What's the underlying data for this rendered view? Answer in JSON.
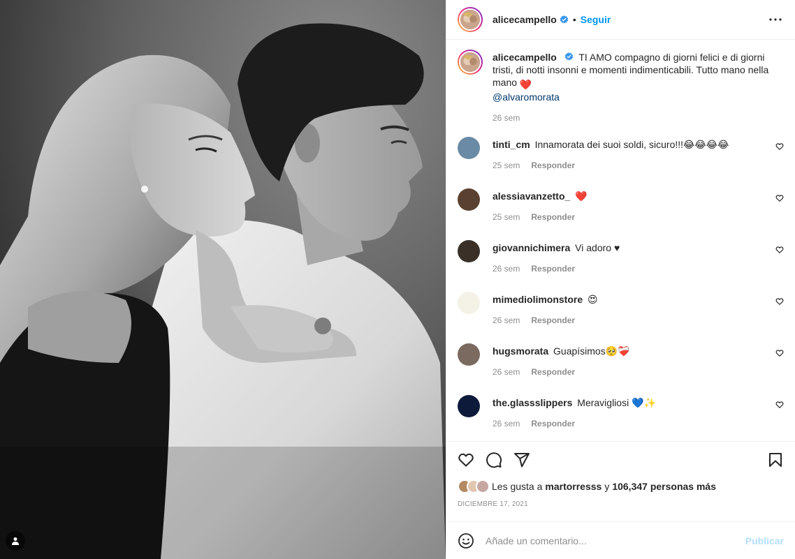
{
  "post": {
    "author": {
      "username": "alicecampello",
      "verified": true,
      "follow_label": "Seguir",
      "separator": "•"
    },
    "caption": {
      "text": "TI AMO compagno di giorni felici e di giorni tristi, di notti insonni e momenti indimenticabili. Tutto mano nella mano",
      "emoji": "❤️",
      "mention": "@alvaromorata",
      "time": "26 sem"
    },
    "comments": [
      {
        "username": "tinti_cm",
        "text": "Innamorata dei suoi soldi, sicuro!!!😂😂😂😂",
        "time": "25 sem",
        "reply_label": "Responder",
        "avatar_color": "#6a8aa5"
      },
      {
        "username": "alessiavanzetto_",
        "text": "❤️",
        "time": "25 sem",
        "reply_label": "Responder",
        "avatar_color": "#5a4030"
      },
      {
        "username": "giovannichimera",
        "text": "Vi adoro ♥",
        "time": "26 sem",
        "reply_label": "Responder",
        "avatar_color": "#3a3028"
      },
      {
        "username": "mimediolimonstore",
        "text": "😍",
        "time": "26 sem",
        "reply_label": "Responder",
        "avatar_color": "#f4f1e6"
      },
      {
        "username": "hugsmorata",
        "text": "Guapísimos🥺❤️‍🩹",
        "time": "26 sem",
        "reply_label": "Responder",
        "avatar_color": "#7a6a60"
      },
      {
        "username": "the.glassslippers",
        "text": "Meravigliosi 💙✨",
        "time": "26 sem",
        "reply_label": "Responder",
        "avatar_color": "#0d1a3a"
      }
    ],
    "likes": {
      "prefix": "Les gusta a",
      "first_liker": "martorresss",
      "joiner": "y",
      "others": "106,347 personas más"
    },
    "date": "DICIEMBRE 17, 2021",
    "add_comment": {
      "placeholder": "Añade un comentario...",
      "publish_label": "Publicar"
    },
    "colors": {
      "accent": "#0095f6",
      "publish_disabled": "#b2dffc",
      "muted": "#8e8e8e",
      "mention": "#00376b",
      "heart_red": "#ed4956"
    },
    "icons": [
      "more-options-icon",
      "verified-badge-icon",
      "like-icon",
      "comment-icon",
      "share-icon",
      "save-icon",
      "emoji-icon",
      "tag-people-icon",
      "comment-like-icon"
    ]
  }
}
